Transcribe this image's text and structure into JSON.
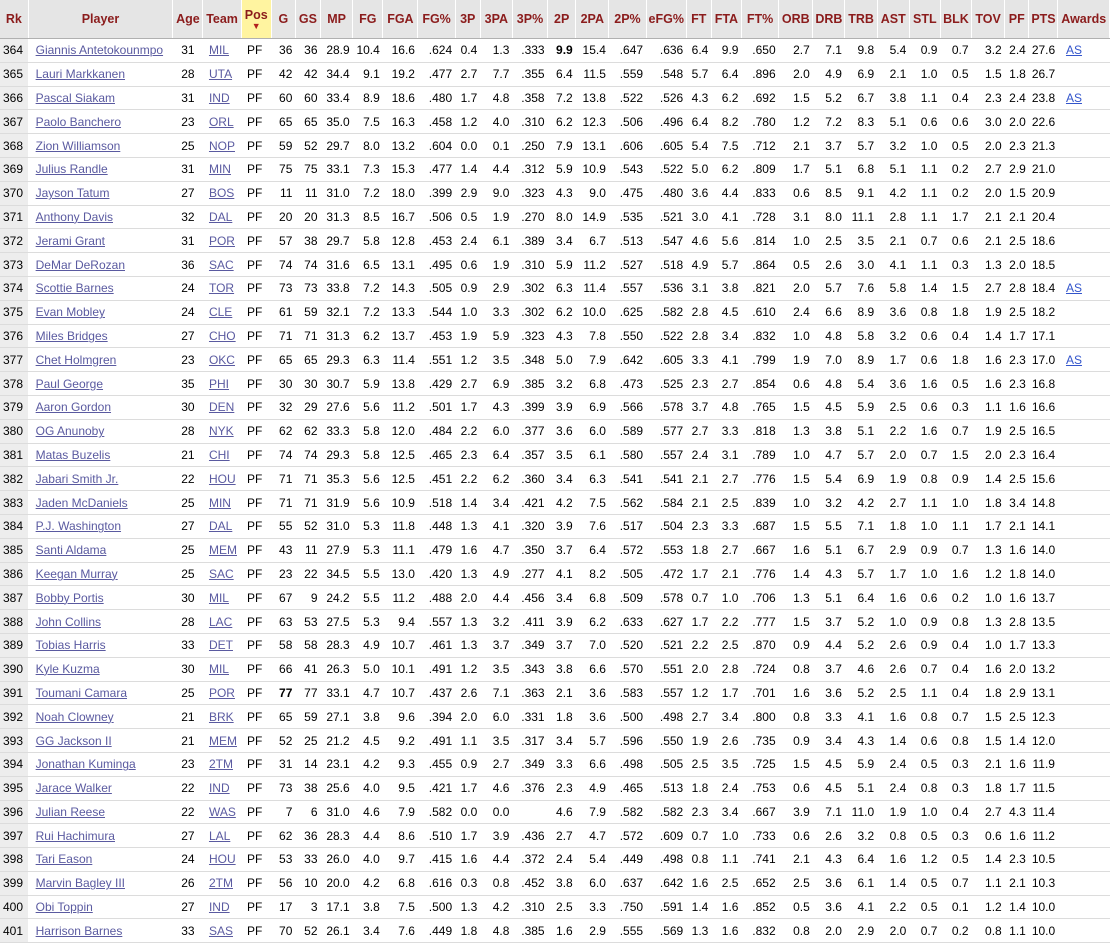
{
  "headers": [
    "Rk",
    "Player",
    "Age",
    "Team",
    "Pos",
    "G",
    "GS",
    "MP",
    "FG",
    "FGA",
    "FG%",
    "3P",
    "3PA",
    "3P%",
    "2P",
    "2PA",
    "2P%",
    "eFG%",
    "FT",
    "FTA",
    "FT%",
    "ORB",
    "DRB",
    "TRB",
    "AST",
    "STL",
    "BLK",
    "TOV",
    "PF",
    "PTS",
    "Awards"
  ],
  "sorted_column_arrow": "▼",
  "rows": [
    [
      "364",
      "Giannis Antetokounmpo",
      "31",
      "MIL",
      "PF",
      "36",
      "36",
      "28.9",
      "10.4",
      "16.6",
      ".624",
      "0.4",
      "1.3",
      ".333",
      "9.9",
      "15.4",
      ".647",
      ".636",
      "6.4",
      "9.9",
      ".650",
      "2.7",
      "7.1",
      "9.8",
      "5.4",
      "0.9",
      "0.7",
      "3.2",
      "2.4",
      "27.6",
      "AS"
    ],
    [
      "365",
      "Lauri Markkanen",
      "28",
      "UTA",
      "PF",
      "42",
      "42",
      "34.4",
      "9.1",
      "19.2",
      ".477",
      "2.7",
      "7.7",
      ".355",
      "6.4",
      "11.5",
      ".559",
      ".548",
      "5.7",
      "6.4",
      ".896",
      "2.0",
      "4.9",
      "6.9",
      "2.1",
      "1.0",
      "0.5",
      "1.5",
      "1.8",
      "26.7",
      ""
    ],
    [
      "366",
      "Pascal Siakam",
      "31",
      "IND",
      "PF",
      "60",
      "60",
      "33.4",
      "8.9",
      "18.6",
      ".480",
      "1.7",
      "4.8",
      ".358",
      "7.2",
      "13.8",
      ".522",
      ".526",
      "4.3",
      "6.2",
      ".692",
      "1.5",
      "5.2",
      "6.7",
      "3.8",
      "1.1",
      "0.4",
      "2.3",
      "2.4",
      "23.8",
      "AS"
    ],
    [
      "367",
      "Paolo Banchero",
      "23",
      "ORL",
      "PF",
      "65",
      "65",
      "35.0",
      "7.5",
      "16.3",
      ".458",
      "1.2",
      "4.0",
      ".310",
      "6.2",
      "12.3",
      ".506",
      ".496",
      "6.4",
      "8.2",
      ".780",
      "1.2",
      "7.2",
      "8.3",
      "5.1",
      "0.6",
      "0.6",
      "3.0",
      "2.0",
      "22.6",
      ""
    ],
    [
      "368",
      "Zion Williamson",
      "25",
      "NOP",
      "PF",
      "59",
      "52",
      "29.7",
      "8.0",
      "13.2",
      ".604",
      "0.0",
      "0.1",
      ".250",
      "7.9",
      "13.1",
      ".606",
      ".605",
      "5.4",
      "7.5",
      ".712",
      "2.1",
      "3.7",
      "5.7",
      "3.2",
      "1.0",
      "0.5",
      "2.0",
      "2.3",
      "21.3",
      ""
    ],
    [
      "369",
      "Julius Randle",
      "31",
      "MIN",
      "PF",
      "75",
      "75",
      "33.1",
      "7.3",
      "15.3",
      ".477",
      "1.4",
      "4.4",
      ".312",
      "5.9",
      "10.9",
      ".543",
      ".522",
      "5.0",
      "6.2",
      ".809",
      "1.7",
      "5.1",
      "6.8",
      "5.1",
      "1.1",
      "0.2",
      "2.7",
      "2.9",
      "21.0",
      ""
    ],
    [
      "370",
      "Jayson Tatum",
      "27",
      "BOS",
      "PF",
      "11",
      "11",
      "31.0",
      "7.2",
      "18.0",
      ".399",
      "2.9",
      "9.0",
      ".323",
      "4.3",
      "9.0",
      ".475",
      ".480",
      "3.6",
      "4.4",
      ".833",
      "0.6",
      "8.5",
      "9.1",
      "4.2",
      "1.1",
      "0.2",
      "2.0",
      "1.5",
      "20.9",
      ""
    ],
    [
      "371",
      "Anthony Davis",
      "32",
      "DAL",
      "PF",
      "20",
      "20",
      "31.3",
      "8.5",
      "16.7",
      ".506",
      "0.5",
      "1.9",
      ".270",
      "8.0",
      "14.9",
      ".535",
      ".521",
      "3.0",
      "4.1",
      ".728",
      "3.1",
      "8.0",
      "11.1",
      "2.8",
      "1.1",
      "1.7",
      "2.1",
      "2.1",
      "20.4",
      ""
    ],
    [
      "372",
      "Jerami Grant",
      "31",
      "POR",
      "PF",
      "57",
      "38",
      "29.7",
      "5.8",
      "12.8",
      ".453",
      "2.4",
      "6.1",
      ".389",
      "3.4",
      "6.7",
      ".513",
      ".547",
      "4.6",
      "5.6",
      ".814",
      "1.0",
      "2.5",
      "3.5",
      "2.1",
      "0.7",
      "0.6",
      "2.1",
      "2.5",
      "18.6",
      ""
    ],
    [
      "373",
      "DeMar DeRozan",
      "36",
      "SAC",
      "PF",
      "74",
      "74",
      "31.6",
      "6.5",
      "13.1",
      ".495",
      "0.6",
      "1.9",
      ".310",
      "5.9",
      "11.2",
      ".527",
      ".518",
      "4.9",
      "5.7",
      ".864",
      "0.5",
      "2.6",
      "3.0",
      "4.1",
      "1.1",
      "0.3",
      "1.3",
      "2.0",
      "18.5",
      ""
    ],
    [
      "374",
      "Scottie Barnes",
      "24",
      "TOR",
      "PF",
      "73",
      "73",
      "33.8",
      "7.2",
      "14.3",
      ".505",
      "0.9",
      "2.9",
      ".302",
      "6.3",
      "11.4",
      ".557",
      ".536",
      "3.1",
      "3.8",
      ".821",
      "2.0",
      "5.7",
      "7.6",
      "5.8",
      "1.4",
      "1.5",
      "2.7",
      "2.8",
      "18.4",
      "AS"
    ],
    [
      "375",
      "Evan Mobley",
      "24",
      "CLE",
      "PF",
      "61",
      "59",
      "32.1",
      "7.2",
      "13.3",
      ".544",
      "1.0",
      "3.3",
      ".302",
      "6.2",
      "10.0",
      ".625",
      ".582",
      "2.8",
      "4.5",
      ".610",
      "2.4",
      "6.6",
      "8.9",
      "3.6",
      "0.8",
      "1.8",
      "1.9",
      "2.5",
      "18.2",
      ""
    ],
    [
      "376",
      "Miles Bridges",
      "27",
      "CHO",
      "PF",
      "71",
      "71",
      "31.3",
      "6.2",
      "13.7",
      ".453",
      "1.9",
      "5.9",
      ".323",
      "4.3",
      "7.8",
      ".550",
      ".522",
      "2.8",
      "3.4",
      ".832",
      "1.0",
      "4.8",
      "5.8",
      "3.2",
      "0.6",
      "0.4",
      "1.4",
      "1.7",
      "17.1",
      ""
    ],
    [
      "377",
      "Chet Holmgren",
      "23",
      "OKC",
      "PF",
      "65",
      "65",
      "29.3",
      "6.3",
      "11.4",
      ".551",
      "1.2",
      "3.5",
      ".348",
      "5.0",
      "7.9",
      ".642",
      ".605",
      "3.3",
      "4.1",
      ".799",
      "1.9",
      "7.0",
      "8.9",
      "1.7",
      "0.6",
      "1.8",
      "1.6",
      "2.3",
      "17.0",
      "AS"
    ],
    [
      "378",
      "Paul George",
      "35",
      "PHI",
      "PF",
      "30",
      "30",
      "30.7",
      "5.9",
      "13.8",
      ".429",
      "2.7",
      "6.9",
      ".385",
      "3.2",
      "6.8",
      ".473",
      ".525",
      "2.3",
      "2.7",
      ".854",
      "0.6",
      "4.8",
      "5.4",
      "3.6",
      "1.6",
      "0.5",
      "1.6",
      "2.3",
      "16.8",
      ""
    ],
    [
      "379",
      "Aaron Gordon",
      "30",
      "DEN",
      "PF",
      "32",
      "29",
      "27.6",
      "5.6",
      "11.2",
      ".501",
      "1.7",
      "4.3",
      ".399",
      "3.9",
      "6.9",
      ".566",
      ".578",
      "3.7",
      "4.8",
      ".765",
      "1.5",
      "4.5",
      "5.9",
      "2.5",
      "0.6",
      "0.3",
      "1.1",
      "1.6",
      "16.6",
      ""
    ],
    [
      "380",
      "OG Anunoby",
      "28",
      "NYK",
      "PF",
      "62",
      "62",
      "33.3",
      "5.8",
      "12.0",
      ".484",
      "2.2",
      "6.0",
      ".377",
      "3.6",
      "6.0",
      ".589",
      ".577",
      "2.7",
      "3.3",
      ".818",
      "1.3",
      "3.8",
      "5.1",
      "2.2",
      "1.6",
      "0.7",
      "1.9",
      "2.5",
      "16.5",
      ""
    ],
    [
      "381",
      "Matas Buzelis",
      "21",
      "CHI",
      "PF",
      "74",
      "74",
      "29.3",
      "5.8",
      "12.5",
      ".465",
      "2.3",
      "6.4",
      ".357",
      "3.5",
      "6.1",
      ".580",
      ".557",
      "2.4",
      "3.1",
      ".789",
      "1.0",
      "4.7",
      "5.7",
      "2.0",
      "0.7",
      "1.5",
      "2.0",
      "2.3",
      "16.4",
      ""
    ],
    [
      "382",
      "Jabari Smith Jr.",
      "22",
      "HOU",
      "PF",
      "71",
      "71",
      "35.3",
      "5.6",
      "12.5",
      ".451",
      "2.2",
      "6.2",
      ".360",
      "3.4",
      "6.3",
      ".541",
      ".541",
      "2.1",
      "2.7",
      ".776",
      "1.5",
      "5.4",
      "6.9",
      "1.9",
      "0.8",
      "0.9",
      "1.4",
      "2.5",
      "15.6",
      ""
    ],
    [
      "383",
      "Jaden McDaniels",
      "25",
      "MIN",
      "PF",
      "71",
      "71",
      "31.9",
      "5.6",
      "10.9",
      ".518",
      "1.4",
      "3.4",
      ".421",
      "4.2",
      "7.5",
      ".562",
      ".584",
      "2.1",
      "2.5",
      ".839",
      "1.0",
      "3.2",
      "4.2",
      "2.7",
      "1.1",
      "1.0",
      "1.8",
      "3.4",
      "14.8",
      ""
    ],
    [
      "384",
      "P.J. Washington",
      "27",
      "DAL",
      "PF",
      "55",
      "52",
      "31.0",
      "5.3",
      "11.8",
      ".448",
      "1.3",
      "4.1",
      ".320",
      "3.9",
      "7.6",
      ".517",
      ".504",
      "2.3",
      "3.3",
      ".687",
      "1.5",
      "5.5",
      "7.1",
      "1.8",
      "1.0",
      "1.1",
      "1.7",
      "2.1",
      "14.1",
      ""
    ],
    [
      "385",
      "Santi Aldama",
      "25",
      "MEM",
      "PF",
      "43",
      "11",
      "27.9",
      "5.3",
      "11.1",
      ".479",
      "1.6",
      "4.7",
      ".350",
      "3.7",
      "6.4",
      ".572",
      ".553",
      "1.8",
      "2.7",
      ".667",
      "1.6",
      "5.1",
      "6.7",
      "2.9",
      "0.9",
      "0.7",
      "1.3",
      "1.6",
      "14.0",
      ""
    ],
    [
      "386",
      "Keegan Murray",
      "25",
      "SAC",
      "PF",
      "23",
      "22",
      "34.5",
      "5.5",
      "13.0",
      ".420",
      "1.3",
      "4.9",
      ".277",
      "4.1",
      "8.2",
      ".505",
      ".472",
      "1.7",
      "2.1",
      ".776",
      "1.4",
      "4.3",
      "5.7",
      "1.7",
      "1.0",
      "1.6",
      "1.2",
      "1.8",
      "14.0",
      ""
    ],
    [
      "387",
      "Bobby Portis",
      "30",
      "MIL",
      "PF",
      "67",
      "9",
      "24.2",
      "5.5",
      "11.2",
      ".488",
      "2.0",
      "4.4",
      ".456",
      "3.4",
      "6.8",
      ".509",
      ".578",
      "0.7",
      "1.0",
      ".706",
      "1.3",
      "5.1",
      "6.4",
      "1.6",
      "0.6",
      "0.2",
      "1.0",
      "1.6",
      "13.7",
      ""
    ],
    [
      "388",
      "John Collins",
      "28",
      "LAC",
      "PF",
      "63",
      "53",
      "27.5",
      "5.3",
      "9.4",
      ".557",
      "1.3",
      "3.2",
      ".411",
      "3.9",
      "6.2",
      ".633",
      ".627",
      "1.7",
      "2.2",
      ".777",
      "1.5",
      "3.7",
      "5.2",
      "1.0",
      "0.9",
      "0.8",
      "1.3",
      "2.8",
      "13.5",
      ""
    ],
    [
      "389",
      "Tobias Harris",
      "33",
      "DET",
      "PF",
      "58",
      "58",
      "28.3",
      "4.9",
      "10.7",
      ".461",
      "1.3",
      "3.7",
      ".349",
      "3.7",
      "7.0",
      ".520",
      ".521",
      "2.2",
      "2.5",
      ".870",
      "0.9",
      "4.4",
      "5.2",
      "2.6",
      "0.9",
      "0.4",
      "1.0",
      "1.7",
      "13.3",
      ""
    ],
    [
      "390",
      "Kyle Kuzma",
      "30",
      "MIL",
      "PF",
      "66",
      "41",
      "26.3",
      "5.0",
      "10.1",
      ".491",
      "1.2",
      "3.5",
      ".343",
      "3.8",
      "6.6",
      ".570",
      ".551",
      "2.0",
      "2.8",
      ".724",
      "0.8",
      "3.7",
      "4.6",
      "2.6",
      "0.7",
      "0.4",
      "1.6",
      "2.0",
      "13.2",
      ""
    ],
    [
      "391",
      "Toumani Camara",
      "25",
      "POR",
      "PF",
      "77",
      "77",
      "33.1",
      "4.7",
      "10.7",
      ".437",
      "2.6",
      "7.1",
      ".363",
      "2.1",
      "3.6",
      ".583",
      ".557",
      "1.2",
      "1.7",
      ".701",
      "1.6",
      "3.6",
      "5.2",
      "2.5",
      "1.1",
      "0.4",
      "1.8",
      "2.9",
      "13.1",
      ""
    ],
    [
      "392",
      "Noah Clowney",
      "21",
      "BRK",
      "PF",
      "65",
      "59",
      "27.1",
      "3.8",
      "9.6",
      ".394",
      "2.0",
      "6.0",
      ".331",
      "1.8",
      "3.6",
      ".500",
      ".498",
      "2.7",
      "3.4",
      ".800",
      "0.8",
      "3.3",
      "4.1",
      "1.6",
      "0.8",
      "0.7",
      "1.5",
      "2.5",
      "12.3",
      ""
    ],
    [
      "393",
      "GG Jackson II",
      "21",
      "MEM",
      "PF",
      "52",
      "25",
      "21.2",
      "4.5",
      "9.2",
      ".491",
      "1.1",
      "3.5",
      ".317",
      "3.4",
      "5.7",
      ".596",
      ".550",
      "1.9",
      "2.6",
      ".735",
      "0.9",
      "3.4",
      "4.3",
      "1.4",
      "0.6",
      "0.8",
      "1.5",
      "1.4",
      "12.0",
      ""
    ],
    [
      "394",
      "Jonathan Kuminga",
      "23",
      "2TM",
      "PF",
      "31",
      "14",
      "23.1",
      "4.2",
      "9.3",
      ".455",
      "0.9",
      "2.7",
      ".349",
      "3.3",
      "6.6",
      ".498",
      ".505",
      "2.5",
      "3.5",
      ".725",
      "1.5",
      "4.5",
      "5.9",
      "2.4",
      "0.5",
      "0.3",
      "2.1",
      "1.6",
      "11.9",
      ""
    ],
    [
      "395",
      "Jarace Walker",
      "22",
      "IND",
      "PF",
      "73",
      "38",
      "25.6",
      "4.0",
      "9.5",
      ".421",
      "1.7",
      "4.6",
      ".376",
      "2.3",
      "4.9",
      ".465",
      ".513",
      "1.8",
      "2.4",
      ".753",
      "0.6",
      "4.5",
      "5.1",
      "2.4",
      "0.8",
      "0.3",
      "1.8",
      "1.7",
      "11.5",
      ""
    ],
    [
      "396",
      "Julian Reese",
      "22",
      "WAS",
      "PF",
      "7",
      "6",
      "31.0",
      "4.6",
      "7.9",
      ".582",
      "0.0",
      "0.0",
      "",
      "4.6",
      "7.9",
      ".582",
      ".582",
      "2.3",
      "3.4",
      ".667",
      "3.9",
      "7.1",
      "11.0",
      "1.9",
      "1.0",
      "0.4",
      "2.7",
      "4.3",
      "11.4",
      ""
    ],
    [
      "397",
      "Rui Hachimura",
      "27",
      "LAL",
      "PF",
      "62",
      "36",
      "28.3",
      "4.4",
      "8.6",
      ".510",
      "1.7",
      "3.9",
      ".436",
      "2.7",
      "4.7",
      ".572",
      ".609",
      "0.7",
      "1.0",
      ".733",
      "0.6",
      "2.6",
      "3.2",
      "0.8",
      "0.5",
      "0.3",
      "0.6",
      "1.6",
      "11.2",
      ""
    ],
    [
      "398",
      "Tari Eason",
      "24",
      "HOU",
      "PF",
      "53",
      "33",
      "26.0",
      "4.0",
      "9.7",
      ".415",
      "1.6",
      "4.4",
      ".372",
      "2.4",
      "5.4",
      ".449",
      ".498",
      "0.8",
      "1.1",
      ".741",
      "2.1",
      "4.3",
      "6.4",
      "1.6",
      "1.2",
      "0.5",
      "1.4",
      "2.3",
      "10.5",
      ""
    ],
    [
      "399",
      "Marvin Bagley III",
      "26",
      "2TM",
      "PF",
      "56",
      "10",
      "20.0",
      "4.2",
      "6.8",
      ".616",
      "0.3",
      "0.8",
      ".452",
      "3.8",
      "6.0",
      ".637",
      ".642",
      "1.6",
      "2.5",
      ".652",
      "2.5",
      "3.6",
      "6.1",
      "1.4",
      "0.5",
      "0.7",
      "1.1",
      "2.1",
      "10.3",
      ""
    ],
    [
      "400",
      "Obi Toppin",
      "27",
      "IND",
      "PF",
      "17",
      "3",
      "17.1",
      "3.8",
      "7.5",
      ".500",
      "1.3",
      "4.2",
      ".310",
      "2.5",
      "3.3",
      ".750",
      ".591",
      "1.4",
      "1.6",
      ".852",
      "0.5",
      "3.6",
      "4.1",
      "2.2",
      "0.5",
      "0.1",
      "1.2",
      "1.4",
      "10.0",
      ""
    ],
    [
      "401",
      "Harrison Barnes",
      "33",
      "SAS",
      "PF",
      "70",
      "52",
      "26.1",
      "3.4",
      "7.6",
      ".449",
      "1.8",
      "4.8",
      ".385",
      "1.6",
      "2.9",
      ".555",
      ".569",
      "1.3",
      "1.6",
      ".832",
      "0.8",
      "2.0",
      "2.9",
      "2.0",
      "0.7",
      "0.2",
      "0.8",
      "1.1",
      "10.0",
      ""
    ]
  ],
  "bold_cells": [
    [
      0,
      14
    ],
    [
      27,
      5
    ]
  ]
}
